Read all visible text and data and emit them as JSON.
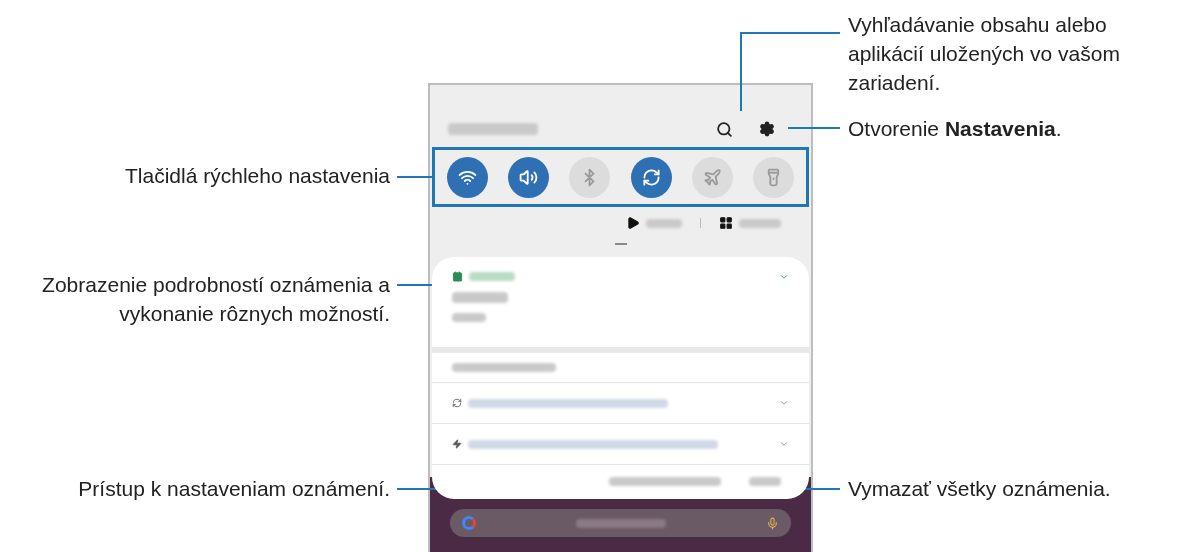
{
  "quick_settings": [
    {
      "kind": "wifi",
      "on": true
    },
    {
      "kind": "sound",
      "on": true
    },
    {
      "kind": "bluetooth",
      "on": false
    },
    {
      "kind": "sync",
      "on": true
    },
    {
      "kind": "airplane",
      "on": false
    },
    {
      "kind": "flashlight",
      "on": false
    }
  ],
  "callouts": [
    {
      "kind": "search",
      "text": "Vyhľadávanie obsahu alebo aplikácií uložených vo vašom zariadení."
    },
    {
      "kind": "settings",
      "text": "Otvorenie **Nastavenia**."
    },
    {
      "kind": "quick",
      "text": "Tlačidlá rýchleho nastavenia"
    },
    {
      "kind": "details",
      "text": "Zobrazenie podrobností oznámenia a vykonanie rôznych možností."
    },
    {
      "kind": "notif_settings",
      "text": "Prístup k nastaveniam oznámení."
    },
    {
      "kind": "clear",
      "text": "Vymazať všetky oznámenia."
    }
  ]
}
